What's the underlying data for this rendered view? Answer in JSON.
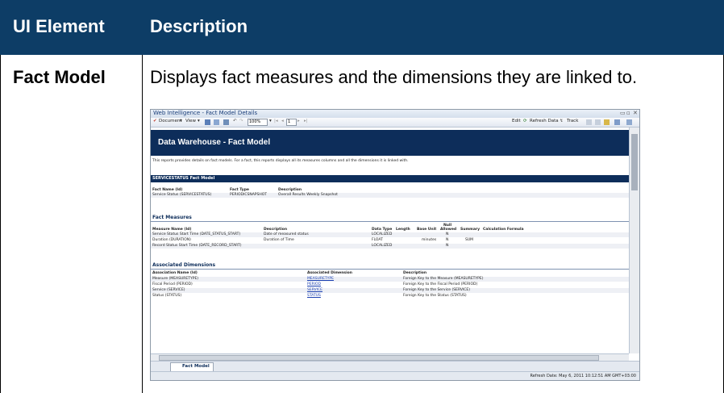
{
  "table": {
    "header_element": "UI Element",
    "header_description": "Description",
    "element_name": "Fact Model",
    "element_description": "Displays fact measures and the dimensions they are linked to."
  },
  "window": {
    "title": "Web Intelligence - Fact Model Details",
    "toolbar": {
      "document": "Document",
      "view": "View",
      "zoom": "100%",
      "page": "1",
      "edit": "Edit",
      "refresh": "Refresh Data",
      "track": "Track"
    },
    "report": {
      "banner_title": "Data Warehouse - Fact Model",
      "intro": "This reports provides details on fact models. For a fact, this reports displays all its measures columns and all the dimensions it is linked with.",
      "fact_section": "SERVICESTATUS Fact Model",
      "fact_headers": [
        "Fact Name (Id)",
        "Fact Type",
        "Description"
      ],
      "fact_row": [
        "Service Status (SERVICESTATUS)",
        "PERIODICSNAPSHOT",
        "Overall Results Weekly Snapshot"
      ],
      "measures_title": "Fact Measures",
      "measures_headers": [
        "Measure Name (Id)",
        "Description",
        "Data Type",
        "Length",
        "Base Unit",
        "Null Allowed",
        "Summary",
        "Calculation Formula"
      ],
      "measures_rows": [
        [
          "Service Status Start Time (DATE_STATUS_START)",
          "Date of measured status",
          "LOCALIZED",
          "",
          "",
          "N",
          "",
          ""
        ],
        [
          "Duration (DURATION)",
          "Duration of Time",
          "FLOAT",
          "",
          "minutes",
          "N",
          "SUM",
          ""
        ],
        [
          "Record Status Start Time (DATE_RECORD_START)",
          "",
          "LOCALIZED",
          "",
          "",
          "N",
          "",
          ""
        ]
      ],
      "dims_title": "Associated Dimensions",
      "dims_headers": [
        "Association Name (Id)",
        "Associated Dimension",
        "Description"
      ],
      "dims_rows": [
        [
          "Measure (MEASURETYPE)",
          "MEASURETYPE",
          "Foreign Key to the Measure (MEASURETYPE)"
        ],
        [
          "Fiscal Period (PERIOD)",
          "PERIOD",
          "Foreign Key to the Fiscal Period (PERIOD)"
        ],
        [
          "Service (SERVICE)",
          "SERVICE",
          "Foreign Key to the Service (SERVICE)"
        ],
        [
          "Status (STATUS)",
          "STATUS",
          "Foreign Key to the Status (STATUS)"
        ]
      ]
    },
    "tab_label": "Fact Model",
    "status_text": "Refresh Date: May 6, 2011 10:12:51 AM GMT+03:00"
  },
  "colors": {
    "header_bg": "#0d3d66",
    "report_banner": "#0d2d5a"
  }
}
